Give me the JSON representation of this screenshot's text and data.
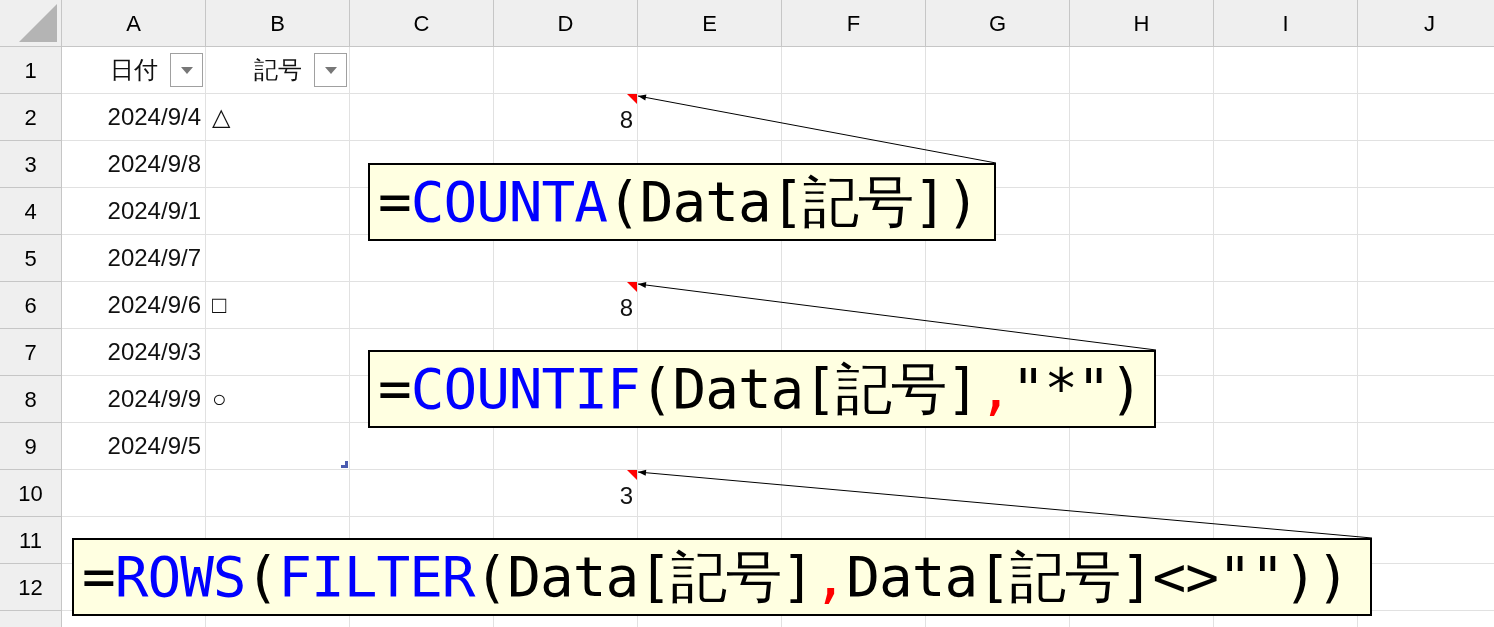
{
  "columns": [
    "A",
    "B",
    "C",
    "D",
    "E",
    "F",
    "G",
    "H",
    "I",
    "J"
  ],
  "header_row": {
    "row": "1",
    "cells": [
      {
        "label": "日付"
      },
      {
        "label": "記号"
      }
    ]
  },
  "rows": [
    {
      "row": "2",
      "date": "2024/9/4",
      "symbol": "△",
      "count": "8",
      "has_comment": true
    },
    {
      "row": "3",
      "date": "2024/9/8",
      "has_comment": false
    },
    {
      "row": "4",
      "date": "2024/9/1",
      "has_comment": false
    },
    {
      "row": "5",
      "date": "2024/9/7",
      "has_comment": false
    },
    {
      "row": "6",
      "date": "2024/9/6",
      "symbol": "□",
      "count": "8",
      "has_comment": true
    },
    {
      "row": "7",
      "date": "2024/9/3",
      "has_comment": false
    },
    {
      "row": "8",
      "date": "2024/9/9",
      "symbol": "○",
      "has_comment": false
    },
    {
      "row": "9",
      "date": "2024/9/5",
      "has_comment": false
    },
    {
      "row": "10",
      "count": "3",
      "has_comment": true
    },
    {
      "row": "11",
      "has_comment": false
    },
    {
      "row": "12",
      "has_comment": false
    }
  ],
  "comments": [
    {
      "segments": [
        {
          "kind": "operator",
          "text": "="
        },
        {
          "kind": "function",
          "text": "COUNTA"
        },
        {
          "kind": "text",
          "text": "(Data[記号])"
        }
      ]
    },
    {
      "segments": [
        {
          "kind": "operator",
          "text": "="
        },
        {
          "kind": "function",
          "text": "COUNTIF"
        },
        {
          "kind": "text",
          "text": "(Data[記号]"
        },
        {
          "kind": "separator",
          "text": ","
        },
        {
          "kind": "text",
          "text": "\"*\")"
        }
      ]
    },
    {
      "segments": [
        {
          "kind": "operator",
          "text": "="
        },
        {
          "kind": "function",
          "text": "ROWS"
        },
        {
          "kind": "text",
          "text": "("
        },
        {
          "kind": "function",
          "text": "FILTER"
        },
        {
          "kind": "text",
          "text": "(Data[記号]"
        },
        {
          "kind": "separator",
          "text": ","
        },
        {
          "kind": "text",
          "text": "Data[記号]<>\"\"))"
        }
      ]
    }
  ]
}
